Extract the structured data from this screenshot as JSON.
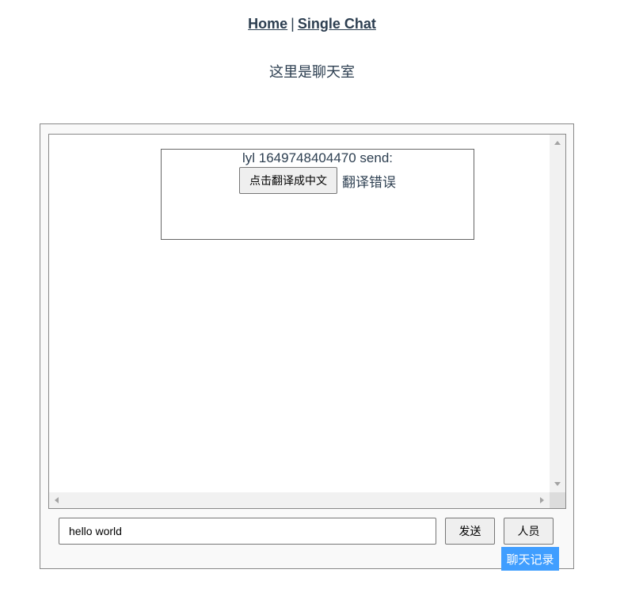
{
  "nav": {
    "home_label": "Home",
    "separator": "|",
    "single_chat_label": "Single Chat"
  },
  "room": {
    "title": "这里是聊天室"
  },
  "messages": [
    {
      "header": "lyl 1649748404470 send:",
      "translate_button_label": "点击翻译成中文",
      "translation_result": "翻译错误"
    }
  ],
  "composer": {
    "input_value": "hello world",
    "send_label": "发送",
    "members_label": "人员",
    "history_label": "聊天记录"
  },
  "colors": {
    "text": "#2c3e50",
    "accent": "#409eff"
  }
}
